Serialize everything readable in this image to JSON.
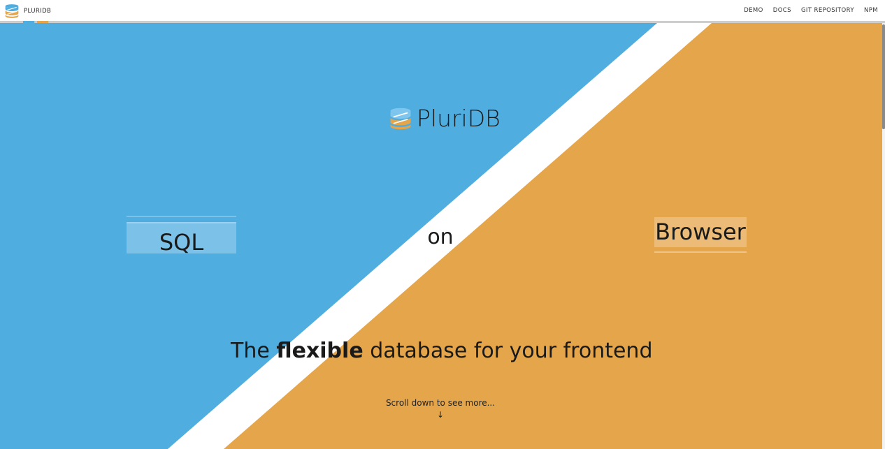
{
  "colors": {
    "blue": "#4fade0",
    "orange": "#e5a54a",
    "white": "#ffffff"
  },
  "header": {
    "brand_name": "PLURIDB",
    "logo_icon": "database-stack-icon",
    "nav": [
      {
        "label": "DEMO"
      },
      {
        "label": "DOCS"
      },
      {
        "label": "GIT REPOSITORY"
      },
      {
        "label": "NPM"
      }
    ]
  },
  "hero": {
    "title": "PluriDB",
    "left_word": "SQL",
    "connector": "on",
    "right_word": "Browser",
    "tagline_before": "The ",
    "tagline_emphasis": "flexible",
    "tagline_after": " database for your frontend",
    "scroll_hint": "Scroll down to see more...",
    "scroll_arrow": "↓"
  }
}
